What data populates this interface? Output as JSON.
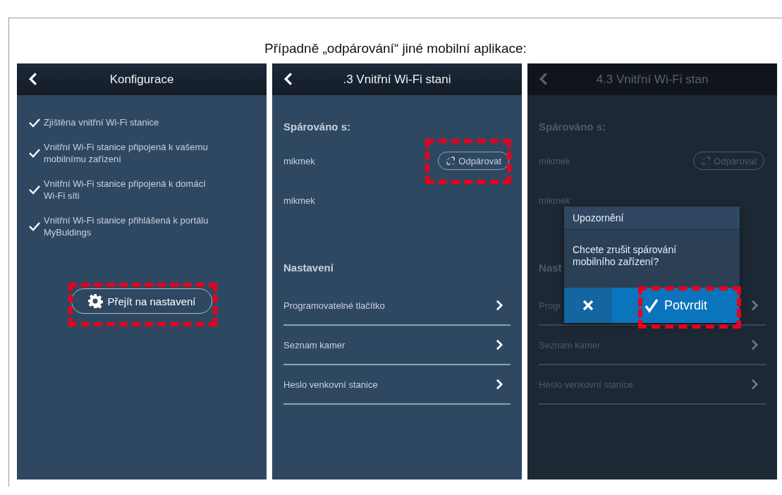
{
  "heading": "Případně „odpárování“ jiné mobilní aplikace:",
  "screens": [
    {
      "kind": "config",
      "dimmed": false,
      "title": "Konfigurace",
      "steps": [
        {
          "text": "Zjištěna vnitřní Wi-Fi stanice",
          "checked": true
        },
        {
          "text": "Vnitřní Wi-Fi stanice připojená k vašemu mobilnímu zařízení",
          "checked": true
        },
        {
          "text": "Vnitřní Wi-Fi stanice připojená k domácí Wi-Fi síti",
          "checked": true
        },
        {
          "text": "Vnitřní Wi-Fi stanice přihlášená k portálu MyBuldings",
          "checked": true
        }
      ],
      "button": {
        "label": "Přejít na nastavení",
        "highlighted": true
      }
    },
    {
      "kind": "device",
      "dimmed": false,
      "title": ".3 Vnitřní Wi-Fi stani",
      "paired_heading": "Spárováno s:",
      "paired": [
        {
          "name": "mikmek",
          "unpair_label": "Odpárovat",
          "highlighted": true
        },
        {
          "name": "mikmek"
        }
      ],
      "settings_heading": "Nastavení",
      "settings": [
        "Programovatelné tlačítko",
        "Seznam kamer",
        "Heslo venkovní stanice"
      ]
    },
    {
      "kind": "device",
      "dimmed": true,
      "title": "4.3 Vnitřní Wi-Fi stan",
      "paired_heading": "Spárováno s:",
      "paired": [
        {
          "name": "mikmek",
          "unpair_label": "Odpárovat"
        },
        {
          "name": "mikmek"
        }
      ],
      "settings_heading": "Nast",
      "settings": [
        "Progr",
        "Seznam kamer",
        "Heslo venkovní stanice"
      ],
      "dialog": {
        "title": "Upozornění",
        "message": "Chcete zrušit spárování mobilního zařízení?",
        "confirm_label": "Potvrdit",
        "highlighted": true
      }
    }
  ]
}
